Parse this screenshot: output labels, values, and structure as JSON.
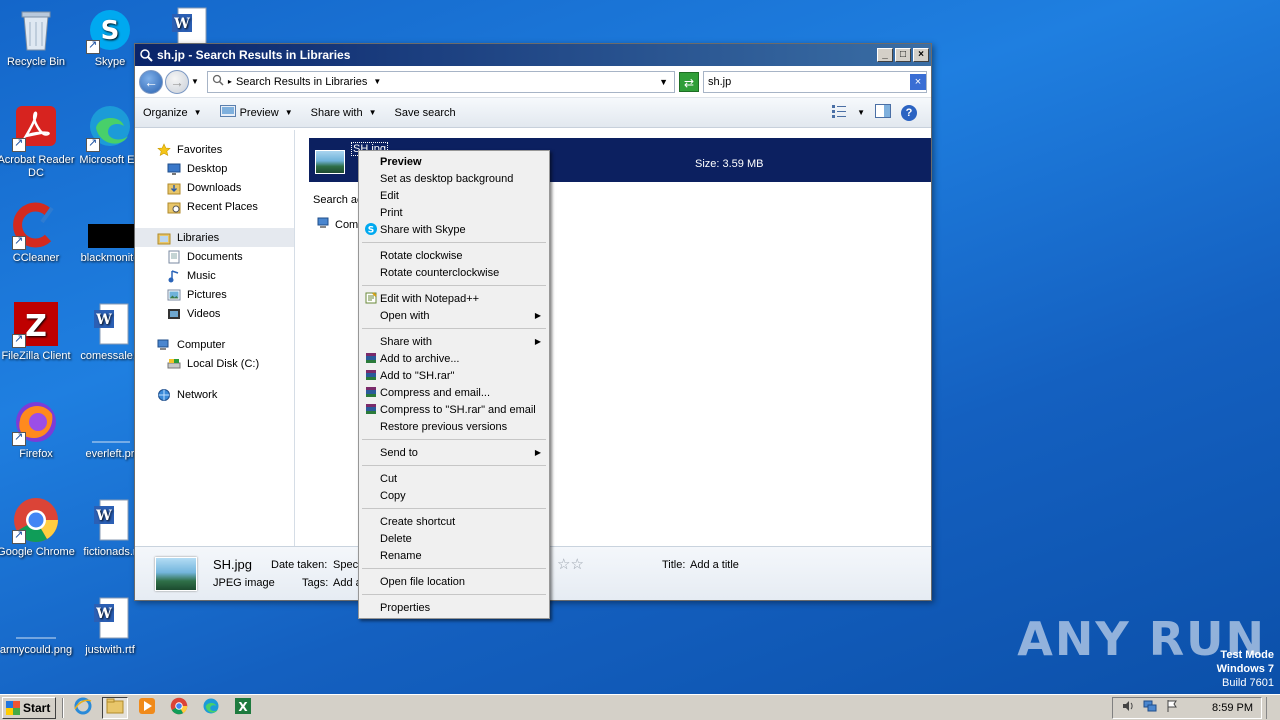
{
  "desktop": {
    "icons": [
      {
        "label": "Recycle Bin"
      },
      {
        "label": "Skype"
      },
      {
        "label": "Acrobat Reader DC"
      },
      {
        "label": "Microsoft Ed"
      },
      {
        "label": "CCleaner"
      },
      {
        "label": "blackmonito"
      },
      {
        "label": "FileZilla Client"
      },
      {
        "label": "comessale.r"
      },
      {
        "label": "Firefox"
      },
      {
        "label": "everleft.pr"
      },
      {
        "label": "Google Chrome"
      },
      {
        "label": "fictionads.r"
      },
      {
        "label": "armycould.png"
      },
      {
        "label": "justwith.rtf"
      }
    ]
  },
  "window": {
    "title": "sh.jp - Search Results in Libraries",
    "address": "Search Results in Libraries",
    "search_value": "sh.jp",
    "commands": {
      "organize": "Organize",
      "preview": "Preview",
      "share_with": "Share with",
      "save_search": "Save search"
    },
    "nav": {
      "favorites": "Favorites",
      "desktop": "Desktop",
      "downloads": "Downloads",
      "recent": "Recent Places",
      "libraries": "Libraries",
      "documents": "Documents",
      "music": "Music",
      "pictures": "Pictures",
      "videos": "Videos",
      "computer": "Computer",
      "local_disk": "Local Disk (C:)",
      "network": "Network"
    },
    "result": {
      "name": "SH.jpg",
      "size": "Size: 3.59 MB"
    },
    "search_again": "Search ac",
    "computer_link": "Com",
    "details": {
      "name": "SH.jpg",
      "type": "JPEG image",
      "date_label": "Date taken:",
      "date_value": "Speci",
      "tags_label": "Tags:",
      "tags_value": "Add a",
      "title_label": "Title:",
      "title_value": "Add a title",
      "rating_stars": "☆☆"
    }
  },
  "context_menu": {
    "groups": [
      [
        "Preview",
        "Set as desktop background",
        "Edit",
        "Print",
        "Share with Skype"
      ],
      [
        "Rotate clockwise",
        "Rotate counterclockwise"
      ],
      [
        "Edit with Notepad++",
        "Open with"
      ],
      [
        "Share with",
        "Add to archive...",
        "Add to \"SH.rar\"",
        "Compress and email...",
        "Compress to \"SH.rar\" and email",
        "Restore previous versions"
      ],
      [
        "Send to"
      ],
      [
        "Cut",
        "Copy"
      ],
      [
        "Create shortcut",
        "Delete",
        "Rename"
      ],
      [
        "Open file location"
      ],
      [
        "Properties"
      ]
    ]
  },
  "watermark": "ANY RUN",
  "test_mode": {
    "line1": "Test Mode",
    "line2": "Windows 7",
    "line3": "Build 7601"
  },
  "taskbar": {
    "start_label": "Start",
    "clock": "8:59 PM"
  },
  "colors": {
    "desktop_bg": "#1a72d6",
    "title_bar": "#0a246a",
    "selection": "#0c2060"
  }
}
